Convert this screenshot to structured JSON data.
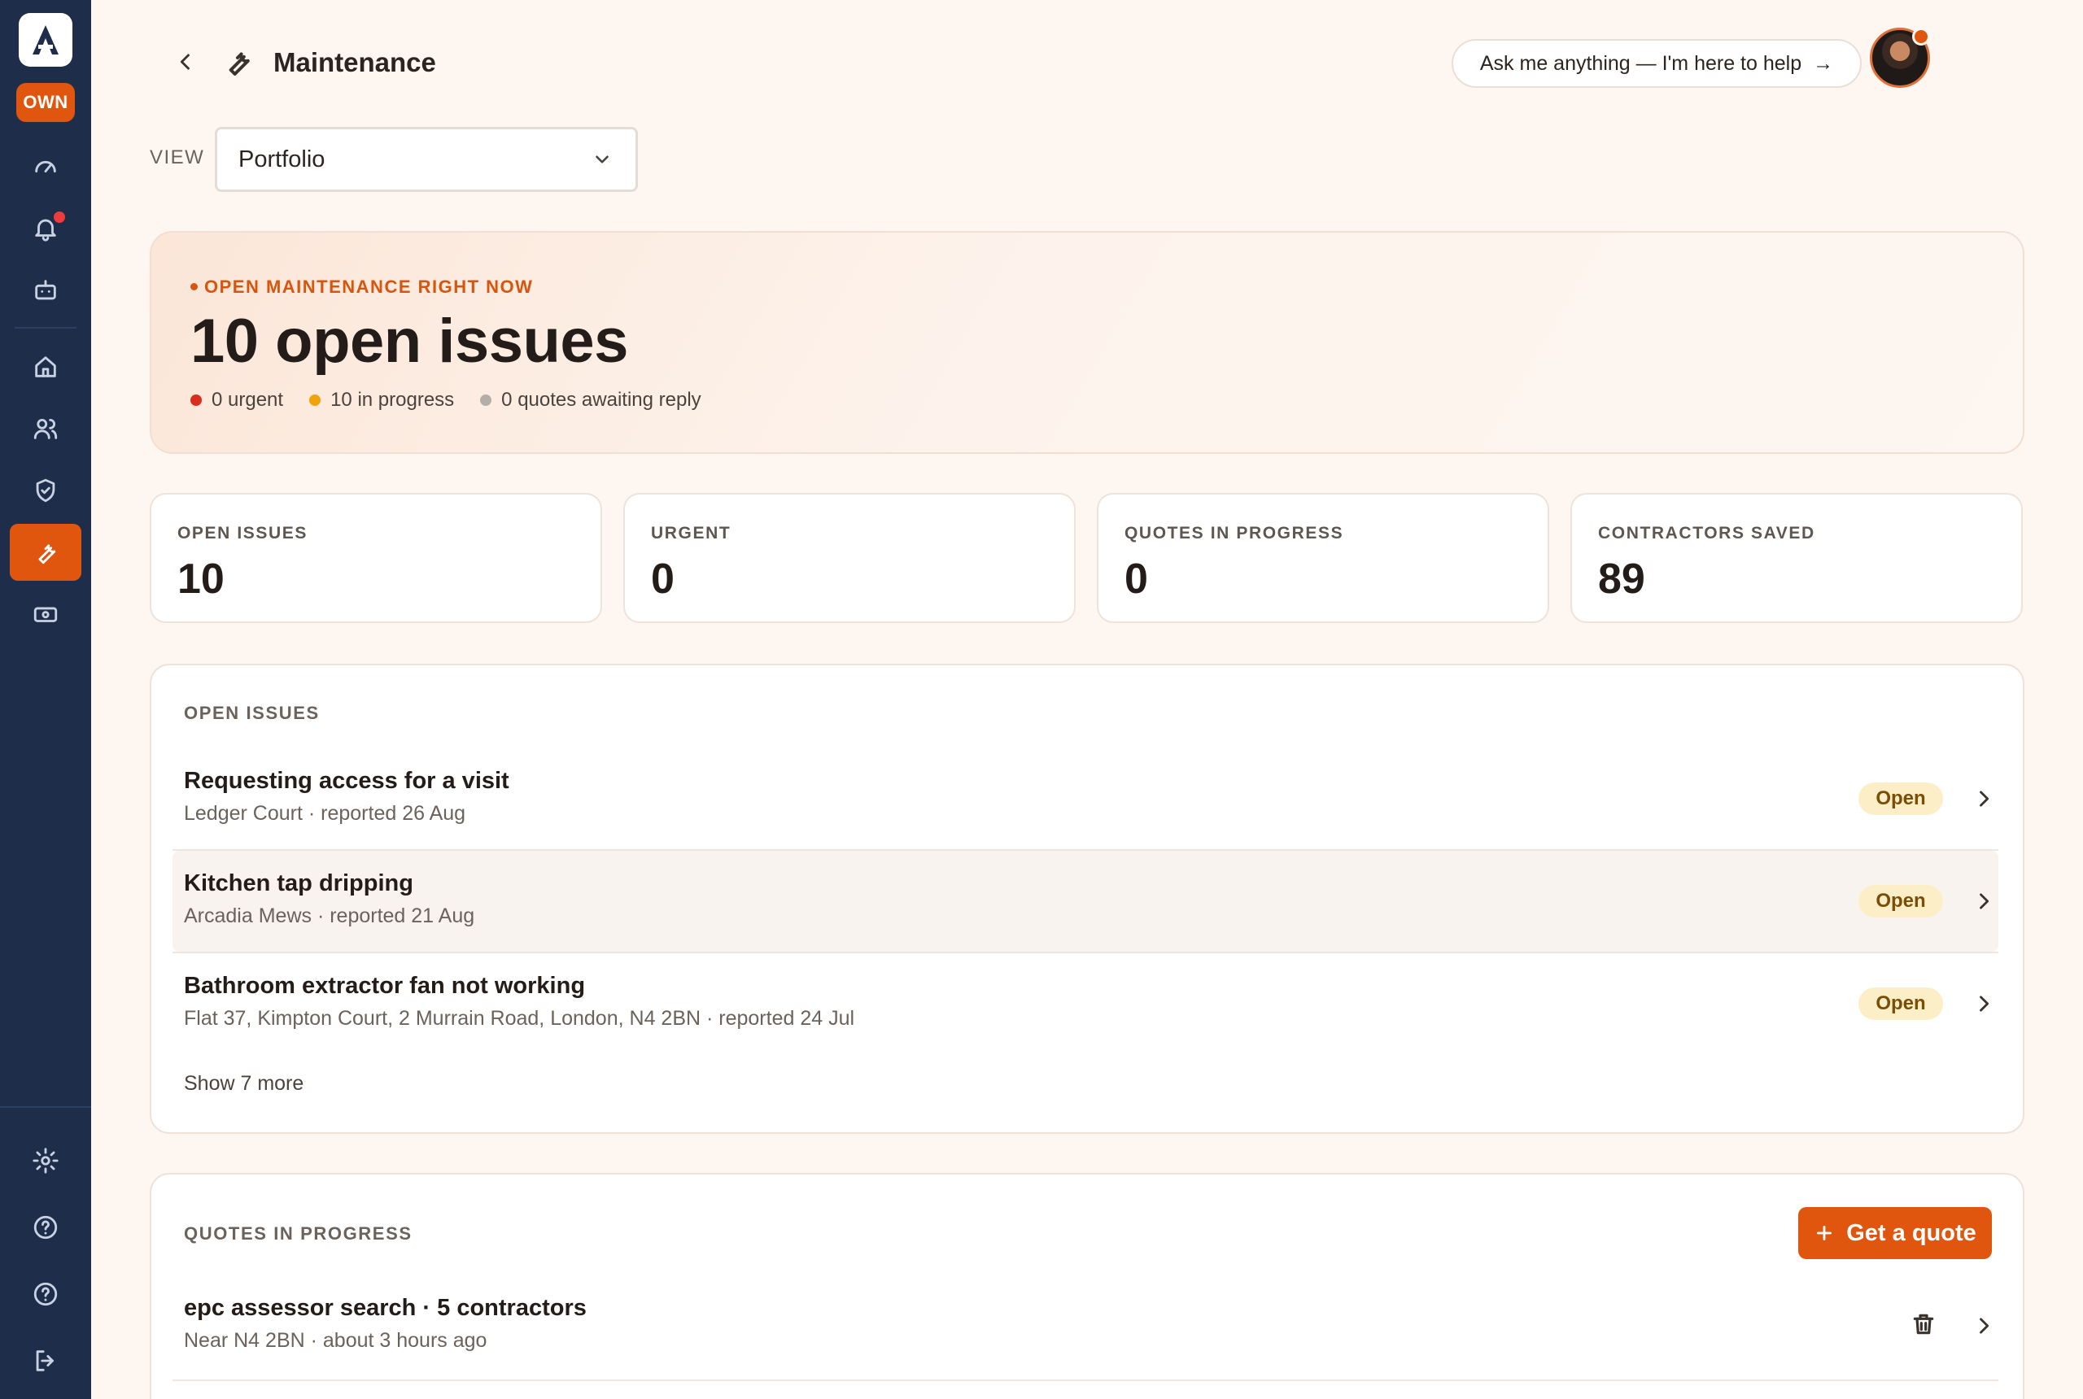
{
  "sidebar": {
    "logo": "A",
    "badge": "OWN",
    "top_icons": [
      "gauge-icon",
      "bell-icon",
      "robot-icon"
    ],
    "main_icons": [
      "home-icon",
      "users-icon",
      "shield-check-icon",
      "wrench-icon",
      "banknote-icon"
    ],
    "active": "wrench-icon",
    "bottom_icons": [
      "gear-icon",
      "help-circle-icon",
      "help-circle-icon",
      "logout-icon"
    ]
  },
  "header": {
    "title": "Maintenance",
    "ask_label": "Ask me anything — I'm here to help",
    "ask_arrow": "→"
  },
  "view": {
    "label": "VIEW",
    "selected": "Portfolio"
  },
  "hero": {
    "kicker": "OPEN MAINTENANCE RIGHT NOW",
    "title": "10 open issues",
    "stats": [
      {
        "text": "0 urgent",
        "color": "#d92d20"
      },
      {
        "text": "10 in progress",
        "color": "#f2a20a"
      },
      {
        "text": "0 quotes awaiting reply",
        "color": "#b5aea8"
      }
    ]
  },
  "stat_cards": [
    {
      "label": "OPEN ISSUES",
      "value": "10"
    },
    {
      "label": "URGENT",
      "value": "0"
    },
    {
      "label": "QUOTES IN PROGRESS",
      "value": "0"
    },
    {
      "label": "CONTRACTORS SAVED",
      "value": "89"
    }
  ],
  "open_issues": {
    "title": "OPEN ISSUES",
    "items": [
      {
        "title": "Requesting access for a visit",
        "sub": "Ledger Court · reported 26 Aug",
        "status": "Open"
      },
      {
        "title": "Kitchen tap dripping",
        "sub": "Arcadia Mews · reported 21 Aug",
        "status": "Open"
      },
      {
        "title": "Bathroom extractor fan not working",
        "sub": "Flat 37, Kimpton Court, 2 Murrain Road, London, N4 2BN · reported 24 Jul",
        "status": "Open"
      }
    ],
    "show_more": "Show 7 more"
  },
  "quotes": {
    "title": "QUOTES IN PROGRESS",
    "button_label": "Get a quote",
    "items": [
      {
        "title": "epc assessor search · 5 contractors",
        "sub": "Near N4 2BN · about 3 hours ago"
      }
    ]
  },
  "colors": {
    "accent": "#e0560f",
    "sidebar": "#1e2d4a",
    "background": "#fdf6f1",
    "pill_bg": "#fcefc8"
  }
}
